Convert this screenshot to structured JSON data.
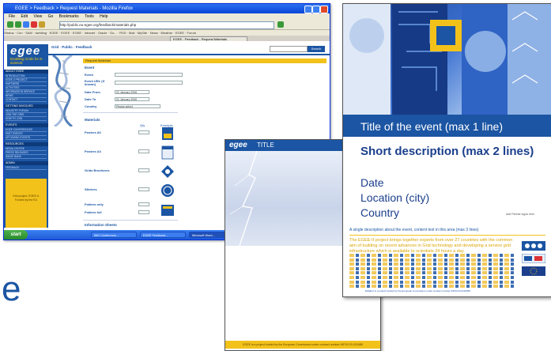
{
  "browser": {
    "window_title": "EGEE > Feedback > Request Materials - Mozilla Firefox",
    "menu": [
      "File",
      "Edit",
      "View",
      "Go",
      "Bookmarks",
      "Tools",
      "Help"
    ],
    "address": "http://public.eu-egee.org/feedback/materials.php",
    "bookmarks": "Stratus · Cnn · SAM · dwhiting · EGEE · EGEE · EGEE · Intranet · Oracle · Go... · RSS · Mail · MySite · News · Weather · EGEE · Forum",
    "tabs": [
      "EGEE - Feedback - Request Materials"
    ],
    "site": {
      "logo": "egee",
      "logo_tagline": "Enabling Grids for E-sciencE",
      "top_links": "Grid · Public · Feedback",
      "search_button": "Search",
      "nav": [
        {
          "section": "ABOUT EGEE",
          "items": [
            "INTRODUCTION",
            "EGEE-II PROJECT",
            "PARTNERS",
            "ACTIVITIES",
            "INFORMATION SERVICE",
            "NEWS",
            "CONTACT"
          ]
        },
        {
          "section": "GETTING INVOLVED",
          "items": [
            "INDUSTRY FORUM",
            "JOIN THE GRID",
            "HOW TO JOIN"
          ]
        },
        {
          "section": "EVENTS",
          "items": [
            "EGEE CONFERENCES",
            "PAST EVENTS",
            "UPCOMING EVENTS"
          ]
        },
        {
          "section": "RESOURCES",
          "items": [
            "MEDIA CENTRE",
            "PRESS RELEASES",
            "IMAGE BANK"
          ]
        },
        {
          "section": "ADMIN",
          "items": [
            "FEEDBACK"
          ]
        }
      ],
      "side_note": "Grid project, EGEE-II. Funded by the EU"
    },
    "form": {
      "header": "Request Materials",
      "event_section": "Event",
      "fields": [
        {
          "label": "Event",
          "value": ""
        },
        {
          "label": "Event URL (if known)",
          "value": ""
        },
        {
          "label": "Date From",
          "value": "01  January  2006"
        },
        {
          "label": "Date To",
          "value": "01  January  2006"
        },
        {
          "label": "Country",
          "value": "Please select"
        }
      ],
      "materials_section": "Materials",
      "columns": [
        "Qty",
        "Example"
      ],
      "materials": [
        "Posters A0",
        "Posters A3",
        "Grids Brochures",
        "Stickers",
        "Folders only",
        "Folders full"
      ],
      "more_section": "Information Sheets"
    },
    "taskbar": {
      "start": "start",
      "tasks": [
        "IMG Conference...",
        "EGEE Feedback...",
        "Microsoft Word...",
        "Inbox - Microsoft..."
      ],
      "clock": "10:41"
    }
  },
  "poster_back": {
    "logo": "egee",
    "title": "TITLE",
    "footer": "EGEE is a project funded by the European Commission under contract number INFSO-RI-031688"
  },
  "poster_front": {
    "title": "Title of the event (max 1 line)",
    "short_description": "Short description (max 2 lines)",
    "date": "Date",
    "location": "Location (city)",
    "country": "Country",
    "aside": "Add Partner logos here",
    "single_description": "A single description about the event, content text in this area (max 3 lines)",
    "project_blurb": "The EGEE-II project brings together experts from over 27 countries with the common aim of building on recent advances in Grid technology and developing a service grid infrastructure which is available to scientists 24 hours a day.",
    "footer": "EGEE-II is a project funded by the European Commission under contract number INFSO-RI-031688"
  },
  "slide_fragment": "e",
  "colors": {
    "egee_blue": "#1b55a3",
    "egee_yellow": "#f3c21a",
    "xp_blue": "#0a46d8"
  }
}
